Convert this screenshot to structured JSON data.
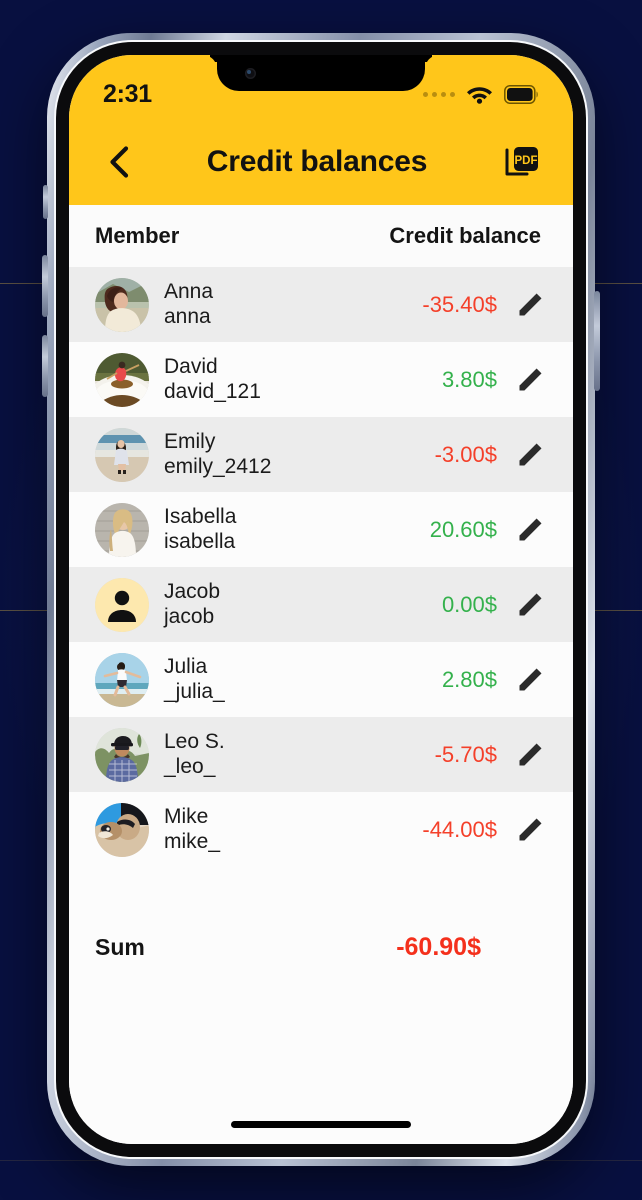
{
  "status_bar": {
    "time": "2:31",
    "signal_icon": "signal-dots-icon",
    "wifi_icon": "wifi-icon",
    "battery_icon": "battery-icon"
  },
  "app_bar": {
    "back_icon": "chevron-left-icon",
    "title": "Credit balances",
    "pdf_icon": "pdf-export-icon"
  },
  "table": {
    "headers": {
      "member": "Member",
      "balance": "Credit balance"
    },
    "rows": [
      {
        "name": "Anna",
        "handle": "anna",
        "balance": "-35.40$",
        "sign": "neg",
        "avatar": "anna-avatar",
        "edit_icon": "edit-pencil-icon"
      },
      {
        "name": "David",
        "handle": "david_121",
        "balance": "3.80$",
        "sign": "pos",
        "avatar": "david-avatar",
        "edit_icon": "edit-pencil-icon"
      },
      {
        "name": "Emily",
        "handle": "emily_2412",
        "balance": "-3.00$",
        "sign": "neg",
        "avatar": "emily-avatar",
        "edit_icon": "edit-pencil-icon"
      },
      {
        "name": "Isabella",
        "handle": "isabella",
        "balance": "20.60$",
        "sign": "pos",
        "avatar": "isabella-avatar",
        "edit_icon": "edit-pencil-icon"
      },
      {
        "name": "Jacob",
        "handle": "jacob",
        "balance": "0.00$",
        "sign": "pos",
        "avatar": "jacob-placeholder-avatar",
        "edit_icon": "edit-pencil-icon"
      },
      {
        "name": "Julia",
        "handle": "_julia_",
        "balance": "2.80$",
        "sign": "pos",
        "avatar": "julia-avatar",
        "edit_icon": "edit-pencil-icon"
      },
      {
        "name": "Leo S.",
        "handle": "_leo_",
        "balance": "-5.70$",
        "sign": "neg",
        "avatar": "leo-avatar",
        "edit_icon": "edit-pencil-icon"
      },
      {
        "name": "Mike",
        "handle": "mike_",
        "balance": "-44.00$",
        "sign": "neg",
        "avatar": "mike-avatar",
        "edit_icon": "edit-pencil-icon"
      }
    ]
  },
  "summary": {
    "label": "Sum",
    "value": "-60.90$"
  },
  "colors": {
    "brand_yellow": "#ffc61a",
    "negative_red": "#f4402a",
    "positive_green": "#34b14c",
    "sum_red": "#f4301c",
    "row_alt": "#ececec",
    "background_navy": "#081040"
  }
}
